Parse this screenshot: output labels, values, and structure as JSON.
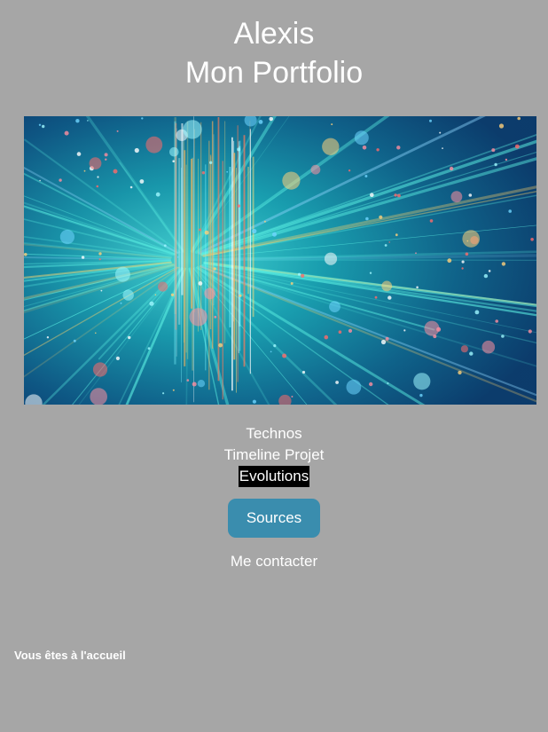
{
  "header": {
    "name": "Alexis",
    "subtitle": "Mon Portfolio"
  },
  "hero": {
    "image_icon": "digital-tunnel-image"
  },
  "nav": {
    "items": [
      {
        "label": "Technos",
        "active": false
      },
      {
        "label": "Timeline Projet",
        "active": false
      },
      {
        "label": "Evolutions",
        "active": true
      }
    ]
  },
  "sources_button": {
    "label": "Sources",
    "color": "#3a8dae"
  },
  "contact": {
    "label": "Me contacter"
  },
  "footer": {
    "location_text": "Vous êtes à l'accueil"
  },
  "colors": {
    "background": "#a6a6a6",
    "text": "#ffffff",
    "active_highlight": "#000000"
  }
}
